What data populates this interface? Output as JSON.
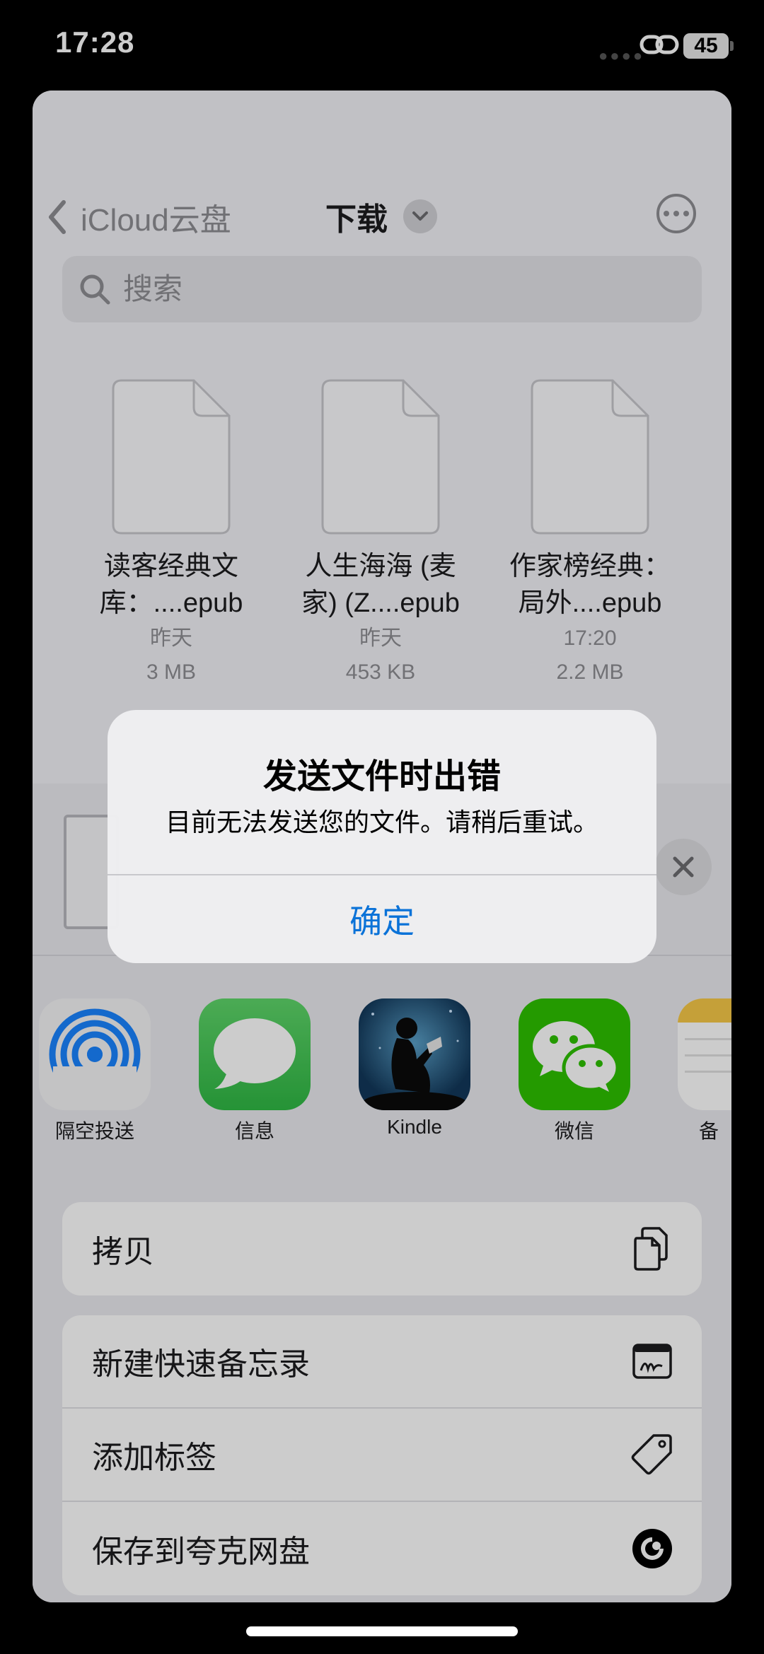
{
  "status": {
    "time": "17:28",
    "battery": "45"
  },
  "nav": {
    "back_label": "iCloud云盘",
    "title": "下载"
  },
  "search": {
    "placeholder": "搜索"
  },
  "files": [
    {
      "name_line1": "读客经典文",
      "name_line2": "库：....epub",
      "date": "昨天",
      "size": "3 MB"
    },
    {
      "name_line1": "人生海海 (麦",
      "name_line2": "家) (Z....epub",
      "date": "昨天",
      "size": "453 KB"
    },
    {
      "name_line1": "作家榜经典：",
      "name_line2": "局外....epub",
      "date": "17:20",
      "size": "2.2 MB"
    }
  ],
  "share_apps": [
    {
      "label": "隔空投送",
      "icon": "airdrop-icon"
    },
    {
      "label": "信息",
      "icon": "messages-icon"
    },
    {
      "label": "Kindle",
      "icon": "kindle-icon"
    },
    {
      "label": "微信",
      "icon": "wechat-icon"
    },
    {
      "label": "备",
      "icon": "notes-icon"
    }
  ],
  "actions": {
    "copy": "拷贝",
    "quick_note": "新建快速备忘录",
    "add_tag": "添加标签",
    "save_quark": "保存到夸克网盘"
  },
  "alert": {
    "title": "发送文件时出错",
    "message": "目前无法发送您的文件。请稍后重试。",
    "ok_label": "确定"
  },
  "colors": {
    "accent": "#0a72d8",
    "messages_green": "#34c759",
    "wechat_green": "#2dc100",
    "airdrop_blue": "#1a84ff"
  }
}
